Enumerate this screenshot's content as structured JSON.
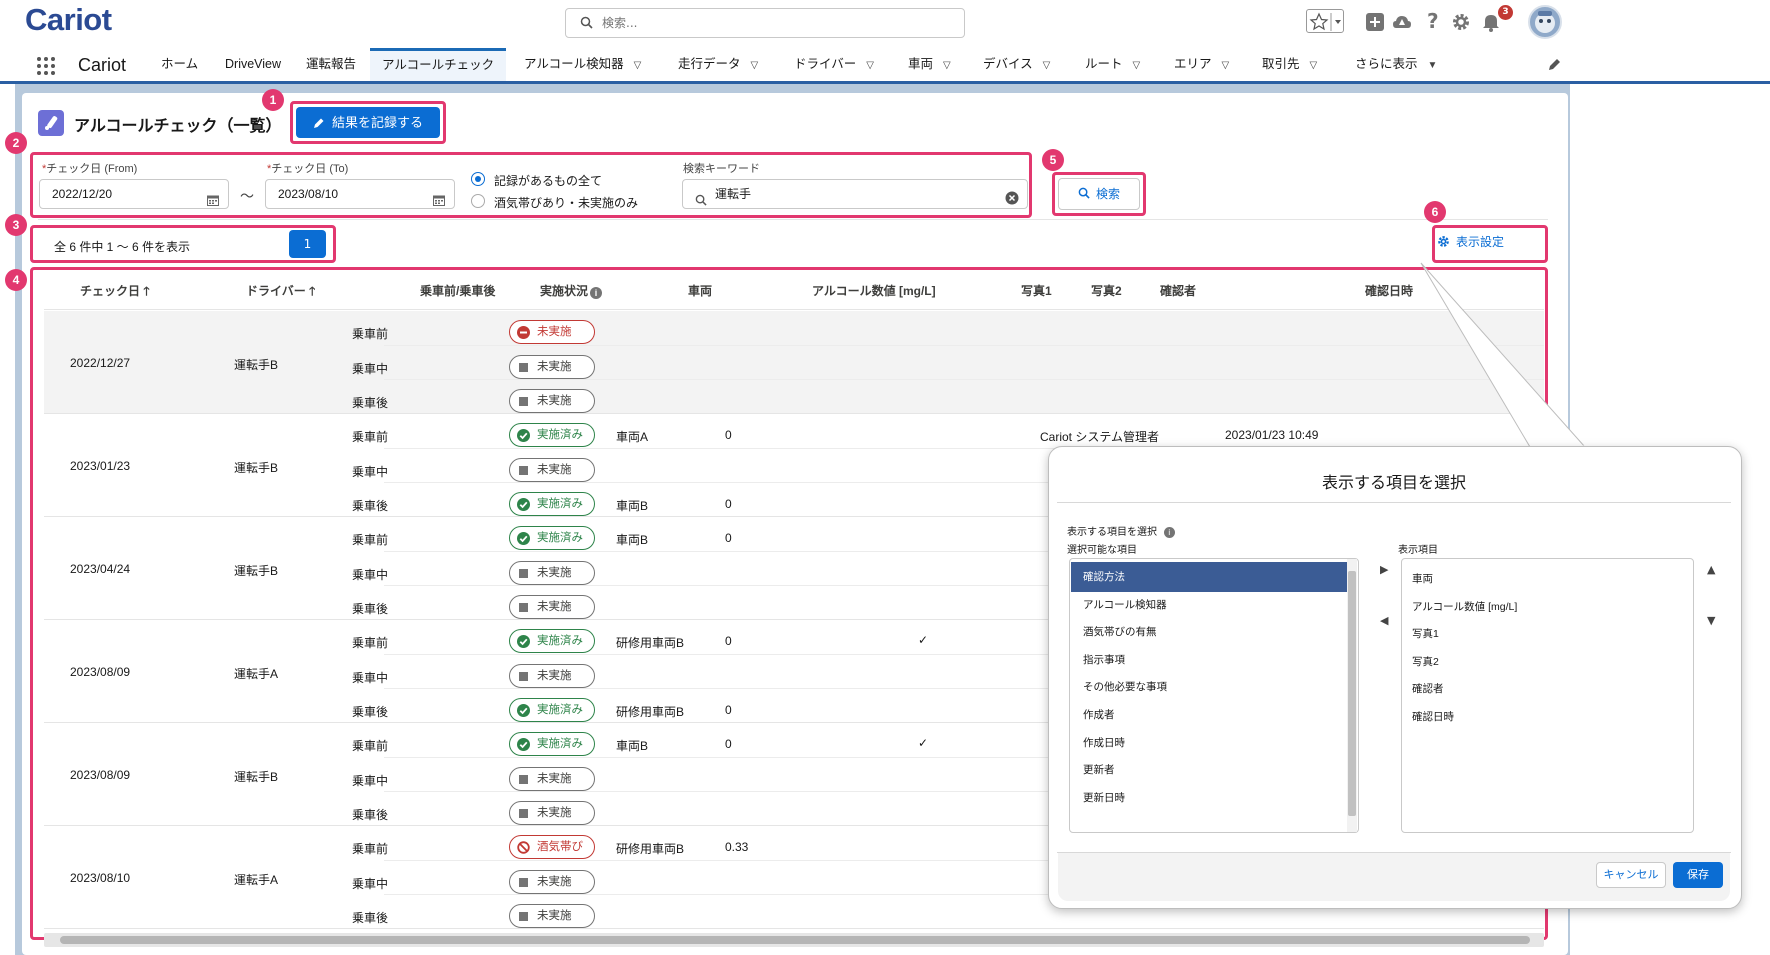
{
  "header": {
    "logo": "Cariot",
    "search_placeholder": "検索...",
    "notification_count": "3"
  },
  "nav": {
    "app_name": "Cariot",
    "items": [
      {
        "label": "ホーム"
      },
      {
        "label": "DriveView"
      },
      {
        "label": "運転報告"
      },
      {
        "label": "アルコールチェック"
      },
      {
        "label": "アルコール検知器"
      },
      {
        "label": "走行データ"
      },
      {
        "label": "ドライバー"
      },
      {
        "label": "車両"
      },
      {
        "label": "デバイス"
      },
      {
        "label": "ルート"
      },
      {
        "label": "エリア"
      },
      {
        "label": "取引先"
      },
      {
        "label": "さらに表示"
      }
    ]
  },
  "page": {
    "title": "アルコールチェック（一覧）",
    "record_button": "結果を記録する"
  },
  "filters": {
    "from_label": "チェック日 (From)",
    "from_value": "2022/12/20",
    "to_label": "チェック日 (To)",
    "to_value": "2023/08/10",
    "range_sep": "～",
    "radio_all": "記録があるもの全て",
    "radio_drunk": "酒気帯びあり・未実施のみ",
    "keyword_label": "検索キーワード",
    "keyword_value": "運転手",
    "search_button": "検索"
  },
  "pager": {
    "summary": "全 6 件中 1 ～ 6 件を表示",
    "page": "1"
  },
  "settings_button": "表示設定",
  "callouts": [
    "1",
    "2",
    "3",
    "4",
    "5",
    "6"
  ],
  "table": {
    "headers": {
      "date": "チェック日",
      "driver": "ドライバー",
      "phase": "乗車前/乗車後",
      "status": "実施状況",
      "vehicle": "車両",
      "alcohol": "アルコール数値 [mg/L]",
      "photo1": "写真1",
      "photo2": "写真2",
      "checker": "確認者",
      "checked_at": "確認日時"
    },
    "groups": [
      {
        "date": "2022/12/27",
        "driver": "運転手B",
        "rows": [
          {
            "phase": "乗車前",
            "status": "未実施",
            "kind": "red-minus",
            "vehicle": "",
            "alcohol": "",
            "photo1": "",
            "checker": "",
            "checked_at": ""
          },
          {
            "phase": "乗車中",
            "status": "未実施",
            "kind": "gray",
            "vehicle": "",
            "alcohol": "",
            "photo1": "",
            "checker": "",
            "checked_at": ""
          },
          {
            "phase": "乗車後",
            "status": "未実施",
            "kind": "gray",
            "vehicle": "",
            "alcohol": "",
            "photo1": "",
            "checker": "",
            "checked_at": ""
          }
        ]
      },
      {
        "date": "2023/01/23",
        "driver": "運転手B",
        "rows": [
          {
            "phase": "乗車前",
            "status": "実施済み",
            "kind": "green",
            "vehicle": "車両A",
            "alcohol": "0",
            "photo1": "",
            "checker": "Cariot システム管理者",
            "checked_at": "2023/01/23 10:49"
          },
          {
            "phase": "乗車中",
            "status": "未実施",
            "kind": "gray",
            "vehicle": "",
            "alcohol": "",
            "photo1": "",
            "checker": "",
            "checked_at": ""
          },
          {
            "phase": "乗車後",
            "status": "実施済み",
            "kind": "green",
            "vehicle": "車両B",
            "alcohol": "0",
            "photo1": "",
            "checker": "",
            "checked_at": ""
          }
        ]
      },
      {
        "date": "2023/04/24",
        "driver": "運転手B",
        "rows": [
          {
            "phase": "乗車前",
            "status": "実施済み",
            "kind": "green",
            "vehicle": "車両B",
            "alcohol": "0",
            "photo1": "",
            "checker": "",
            "checked_at": ""
          },
          {
            "phase": "乗車中",
            "status": "未実施",
            "kind": "gray",
            "vehicle": "",
            "alcohol": "",
            "photo1": "",
            "checker": "",
            "checked_at": ""
          },
          {
            "phase": "乗車後",
            "status": "未実施",
            "kind": "gray",
            "vehicle": "",
            "alcohol": "",
            "photo1": "",
            "checker": "",
            "checked_at": ""
          }
        ]
      },
      {
        "date": "2023/08/09",
        "driver": "運転手A",
        "rows": [
          {
            "phase": "乗車前",
            "status": "実施済み",
            "kind": "green",
            "vehicle": "研修用車両B",
            "alcohol": "0",
            "photo1": "✓",
            "checker": "",
            "checked_at": ""
          },
          {
            "phase": "乗車中",
            "status": "未実施",
            "kind": "gray",
            "vehicle": "",
            "alcohol": "",
            "photo1": "",
            "checker": "",
            "checked_at": ""
          },
          {
            "phase": "乗車後",
            "status": "実施済み",
            "kind": "green",
            "vehicle": "研修用車両B",
            "alcohol": "0",
            "photo1": "",
            "checker": "",
            "checked_at": ""
          }
        ]
      },
      {
        "date": "2023/08/09",
        "driver": "運転手B",
        "rows": [
          {
            "phase": "乗車前",
            "status": "実施済み",
            "kind": "green",
            "vehicle": "車両B",
            "alcohol": "0",
            "photo1": "✓",
            "checker": "",
            "checked_at": ""
          },
          {
            "phase": "乗車中",
            "status": "未実施",
            "kind": "gray",
            "vehicle": "",
            "alcohol": "",
            "photo1": "",
            "checker": "",
            "checked_at": ""
          },
          {
            "phase": "乗車後",
            "status": "未実施",
            "kind": "gray",
            "vehicle": "",
            "alcohol": "",
            "photo1": "",
            "checker": "",
            "checked_at": ""
          }
        ]
      },
      {
        "date": "2023/08/10",
        "driver": "運転手A",
        "rows": [
          {
            "phase": "乗車前",
            "status": "酒気帯び",
            "kind": "red-ban",
            "vehicle": "研修用車両B",
            "alcohol": "0.33",
            "photo1": "",
            "checker": "",
            "checked_at": ""
          },
          {
            "phase": "乗車中",
            "status": "未実施",
            "kind": "gray",
            "vehicle": "",
            "alcohol": "",
            "photo1": "",
            "checker": "",
            "checked_at": ""
          },
          {
            "phase": "乗車後",
            "status": "未実施",
            "kind": "gray",
            "vehicle": "",
            "alcohol": "",
            "photo1": "",
            "checker": "",
            "checked_at": ""
          }
        ]
      }
    ]
  },
  "popup": {
    "title": "表示する項目を選択",
    "section_label": "表示する項目を選択",
    "available_label": "選択可能な項目",
    "selected_label": "表示項目",
    "available": [
      "確認方法",
      "アルコール検知器",
      "酒気帯びの有無",
      "指示事項",
      "その他必要な事項",
      "作成者",
      "作成日時",
      "更新者",
      "更新日時"
    ],
    "selected": [
      "車両",
      "アルコール数値 [mg/L]",
      "写真1",
      "写真2",
      "確認者",
      "確認日時"
    ],
    "cancel": "キャンセル",
    "save": "保存"
  },
  "colors": {
    "brand": "#0b6dd3",
    "callout": "#e2386f",
    "success": "#2e844a",
    "error": "#c23934",
    "logo": "#2b4a93"
  }
}
